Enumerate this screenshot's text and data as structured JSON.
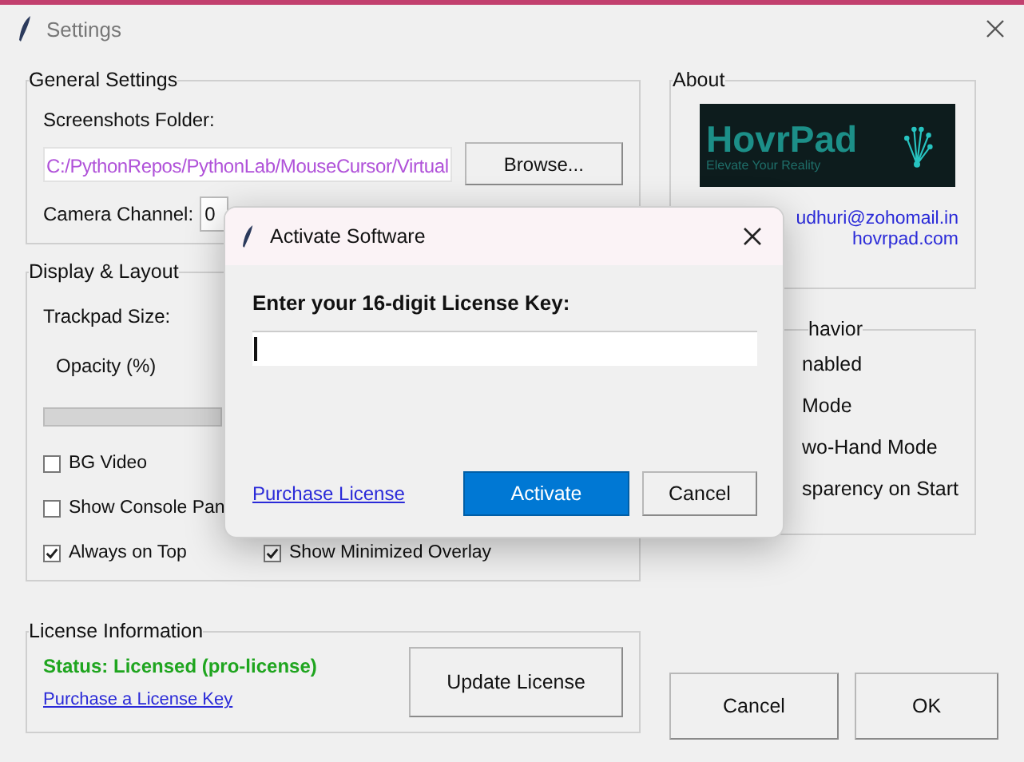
{
  "window": {
    "title": "Settings"
  },
  "general_settings": {
    "title": "General Settings",
    "folder_label": "Screenshots Folder:",
    "folder_value": "C:/PythonRepos/PythonLab/MouseCursor/Virtual",
    "browse_button": "Browse...",
    "camera_label": "Camera Channel:",
    "camera_value": "0"
  },
  "display_layout": {
    "title": "Display & Layout",
    "trackpad_label": "Trackpad Size:",
    "opacity_label": "Opacity (%)",
    "options": [
      {
        "label": "BG Video",
        "checked": false
      },
      {
        "label": "Show Console Pan",
        "checked": false
      },
      {
        "label": "Always on Top",
        "checked": true
      },
      {
        "label": "Show Minimized Overlay",
        "checked": true
      }
    ]
  },
  "license_info": {
    "title": "License Information",
    "status": "Status: Licensed (pro-license)",
    "purchase_link": "Purchase a License Key",
    "update_button": "Update License"
  },
  "about": {
    "title": "About",
    "logo": {
      "name": "HovrPad",
      "tagline": "Elevate Your Reality"
    },
    "links": [
      "udhuri@zohomail.in",
      "hovrpad.com"
    ]
  },
  "behavior": {
    "title": "havior",
    "options": [
      "nabled",
      "Mode",
      "wo-Hand Mode",
      "sparency on Start"
    ]
  },
  "buttons": [
    "Cancel",
    "OK"
  ],
  "dialog": {
    "title": "Activate Software",
    "prompt": "Enter your 16-digit License Key:",
    "purchase_link": "Purchase License",
    "buttons": [
      {
        "label": "Activate",
        "kind": "primary"
      },
      {
        "label": "Cancel",
        "kind": "secondary"
      }
    ]
  }
}
